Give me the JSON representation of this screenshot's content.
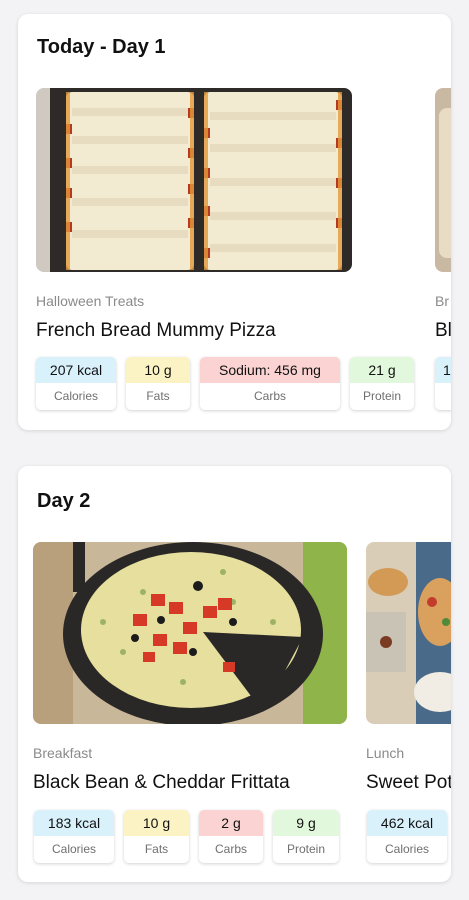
{
  "days": [
    {
      "title": "Today - Day 1",
      "recipes": [
        {
          "category": "Halloween Treats",
          "name": "French Bread Mummy Pizza",
          "nutrients": [
            {
              "value": "207 kcal",
              "label": "Calories",
              "color": "#d8f1fb"
            },
            {
              "value": "10 g",
              "label": "Fats",
              "color": "#fbf3c4"
            },
            {
              "value": "Sodium: 456 mg",
              "label": "Carbs",
              "color": "#fbd3d3"
            },
            {
              "value": "21 g",
              "label": "Protein",
              "color": "#e2f8dc"
            }
          ]
        },
        {
          "category": "Br",
          "name": "Bl",
          "nutrients": [
            {
              "value": "1",
              "label": "",
              "color": "#d8f1fb"
            }
          ]
        }
      ]
    },
    {
      "title": "Day 2",
      "recipes": [
        {
          "category": "Breakfast",
          "name": "Black Bean & Cheddar Frittata",
          "nutrients": [
            {
              "value": "183 kcal",
              "label": "Calories",
              "color": "#d8f1fb"
            },
            {
              "value": "10 g",
              "label": "Fats",
              "color": "#fbf3c4"
            },
            {
              "value": "2 g",
              "label": "Carbs",
              "color": "#fbd3d3"
            },
            {
              "value": "9 g",
              "label": "Protein",
              "color": "#e2f8dc"
            }
          ]
        },
        {
          "category": "Lunch",
          "name": "Sweet Pot",
          "nutrients": [
            {
              "value": "462 kcal",
              "label": "Calories",
              "color": "#d8f1fb"
            }
          ]
        }
      ]
    }
  ]
}
